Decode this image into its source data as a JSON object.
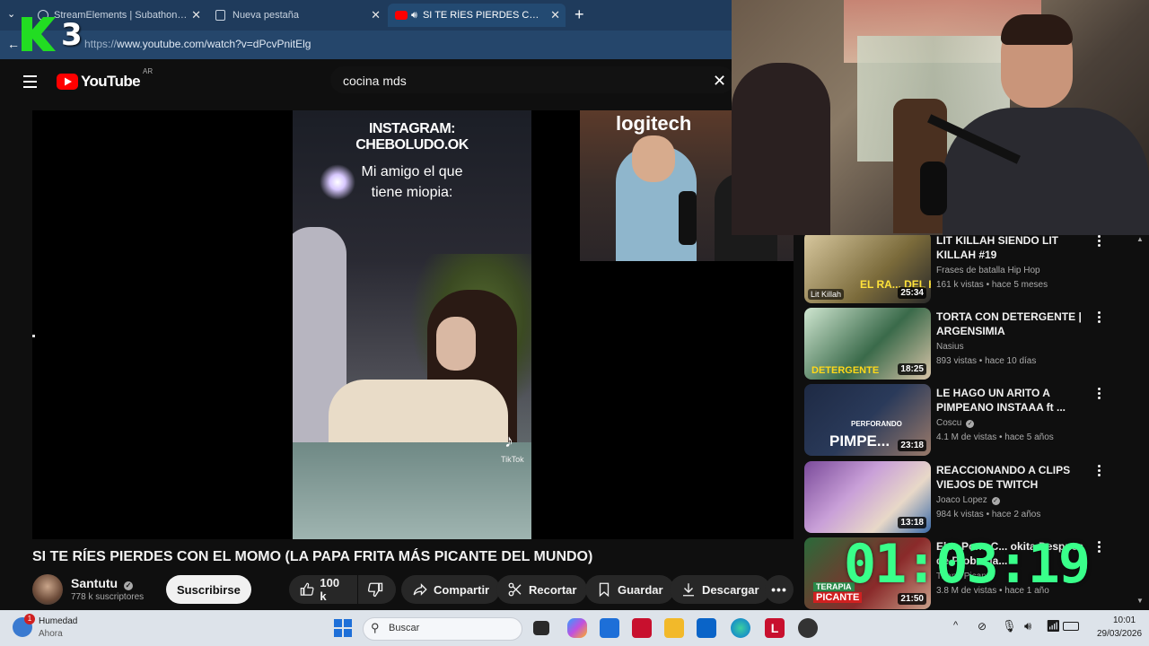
{
  "browser": {
    "tabs": [
      {
        "label": "StreamElements | Subathon Count",
        "active": false
      },
      {
        "label": "Nueva pestaña",
        "active": false
      },
      {
        "label": "SI TE RÍES PIERDES CON EL M",
        "active": true
      }
    ],
    "url_scheme": "https://",
    "url_rest": "www.youtube.com/watch?v=dPcvPnitElg"
  },
  "overlay": {
    "logo_text": "3",
    "timer": "01:03:19"
  },
  "youtube": {
    "logo_text": "YouTube",
    "region": "AR",
    "search_query": "cocina mds"
  },
  "video_frame": {
    "caption_line1": "INSTAGRAM:",
    "caption_line2": "CHEBOLUDO.OK",
    "subtitle_line1": "Mi amigo el que",
    "subtitle_line2": "tiene miopia:",
    "watermark": "TikTok",
    "inset_text": "logitech"
  },
  "video": {
    "title": "SI TE RÍES PIERDES CON EL MOMO (LA PAPA FRITA MÁS PICANTE DEL MUNDO)",
    "channel": "Santutu",
    "subscribers": "778 k suscriptores",
    "subscribe_label": "Suscribirse",
    "likes": "100 k",
    "share_label": "Compartir",
    "clip_label": "Recortar",
    "save_label": "Guardar",
    "download_label": "Descargar"
  },
  "recommendations": [
    {
      "title": "LIT KILLAH SIENDO LIT KILLAH #19",
      "channel": "Frases de batalla Hip Hop",
      "meta": "161 k vistas • hace 5 meses",
      "duration": "25:34",
      "thumb_text": "EL RA... DEL H...",
      "badge": "Lit Killah",
      "verified": false,
      "color": "#7a6a3a"
    },
    {
      "title": "TORTA CON DETERGENTE | ARGENSIMIA",
      "channel": "Nasius",
      "meta": "893 vistas • hace 10 días",
      "duration": "18:25",
      "thumb_text": "DETERGENTE",
      "badge": "",
      "verified": false,
      "color": "#3a6a4a"
    },
    {
      "title": "LE HAGO UN ARITO A PIMPEANO INSTAAA ft ...",
      "channel": "Coscu",
      "meta": "4.1 M de vistas • hace 5 años",
      "duration": "23:18",
      "thumb_text": "PIMPE...",
      "badge": "PERFORANDO",
      "verified": true,
      "color": "#2a3a5a"
    },
    {
      "title": "REACCIONANDO A CLIPS VIEJOS DE TWITCH",
      "channel": "Joaco Lopez",
      "meta": "984 k vistas • hace 2 años",
      "duration": "13:18",
      "thumb_text": "",
      "badge": "",
      "verified": true,
      "color": "#6a4a7a"
    },
    {
      "title": "El ... Pone C... okita Despues de Probar la...",
      "channel": "Tirano Picante",
      "meta": "3.8 M de vistas • hace 1 año",
      "duration": "21:50",
      "thumb_text": "PICANTE",
      "badge": "TERAPIA",
      "verified": false,
      "color": "#8a2a2a"
    }
  ],
  "taskbar": {
    "weather_title": "Humedad",
    "weather_sub": "Ahora",
    "notification_count": "1",
    "search_placeholder": "Buscar",
    "time": "10:01",
    "date": "29/03/2026"
  },
  "colors": {
    "youtube_red": "#ff0000",
    "timer_green": "#39ff8a",
    "logo_green": "#22dd22",
    "browser_blue": "#1f3b5c"
  }
}
